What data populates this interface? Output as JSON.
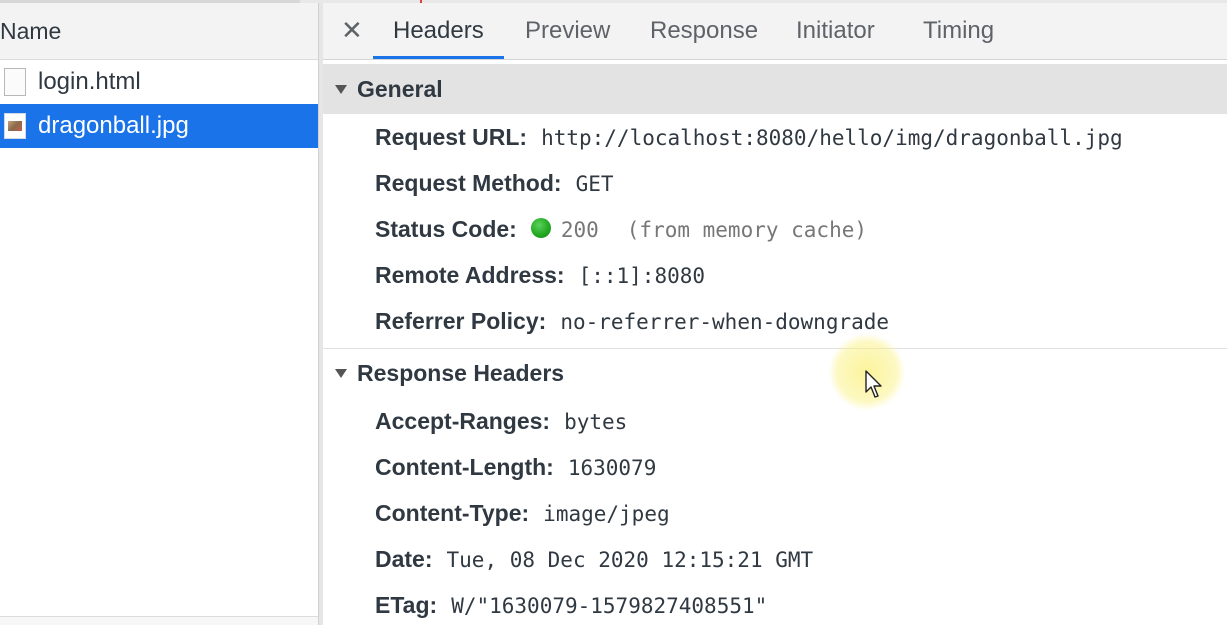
{
  "request_list": {
    "column_header": "Name",
    "items": [
      {
        "name": "login.html",
        "icon": "html-document-icon"
      },
      {
        "name": "dragonball.jpg",
        "icon": "image-file-icon"
      }
    ]
  },
  "details": {
    "close_glyph": "✕",
    "tabs": [
      "Headers",
      "Preview",
      "Response",
      "Initiator",
      "Timing"
    ],
    "active_tab": "Headers",
    "general": {
      "title": "General",
      "request_url_label": "Request URL:",
      "request_url": "http://localhost:8080/hello/img/dragonball.jpg",
      "request_method_label": "Request Method:",
      "request_method": "GET",
      "status_code_label": "Status Code:",
      "status_code": "200",
      "status_note": "(from memory cache)",
      "remote_address_label": "Remote Address:",
      "remote_address": "[::1]:8080",
      "referrer_policy_label": "Referrer Policy:",
      "referrer_policy": "no-referrer-when-downgrade"
    },
    "response_headers": {
      "title": "Response Headers",
      "accept_ranges_label": "Accept-Ranges:",
      "accept_ranges": "bytes",
      "content_length_label": "Content-Length:",
      "content_length": "1630079",
      "content_type_label": "Content-Type:",
      "content_type": "image/jpeg",
      "date_label": "Date:",
      "date": "Tue, 08 Dec 2020 12:15:21 GMT",
      "etag_label": "ETag:",
      "etag": "W/\"1630079-1579827408551\""
    }
  },
  "colors": {
    "selected_row": "#1a73e8",
    "active_tab_underline": "#1a73e8",
    "status_ok": "#23a923",
    "section_header_bg": "#e3e3e3"
  }
}
